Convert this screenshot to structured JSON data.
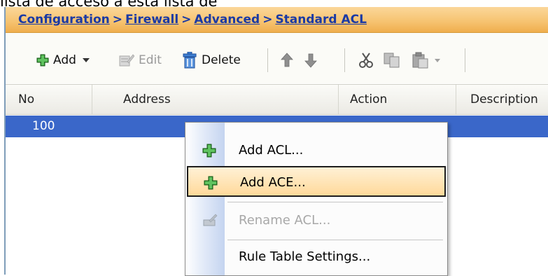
{
  "caption": "lista de acceso a esta lista de",
  "breadcrumb": {
    "items": [
      "Configuration",
      "Firewall",
      "Advanced",
      "Standard ACL"
    ],
    "separator": ">"
  },
  "toolbar": {
    "add_label": "Add",
    "edit_label": "Edit",
    "delete_label": "Delete"
  },
  "table": {
    "columns": [
      "No",
      "Address",
      "Action",
      "Description"
    ],
    "selected_row": {
      "no": "100"
    }
  },
  "context_menu": {
    "items": [
      {
        "label": "Add ACL...",
        "icon": "green-plus-icon",
        "state": "normal"
      },
      {
        "label": "Add ACE...",
        "icon": "green-plus-icon",
        "state": "hover"
      },
      {
        "label": "Rename ACL...",
        "icon": "rename-icon",
        "state": "disabled"
      },
      {
        "label": "Rule Table Settings...",
        "icon": "",
        "state": "normal"
      }
    ]
  },
  "colors": {
    "header_bar": "#f6c26f",
    "breadcrumb_link": "#1a3aa5",
    "selected_row": "#3a67c9",
    "menu_hover": "#ffd99a"
  }
}
